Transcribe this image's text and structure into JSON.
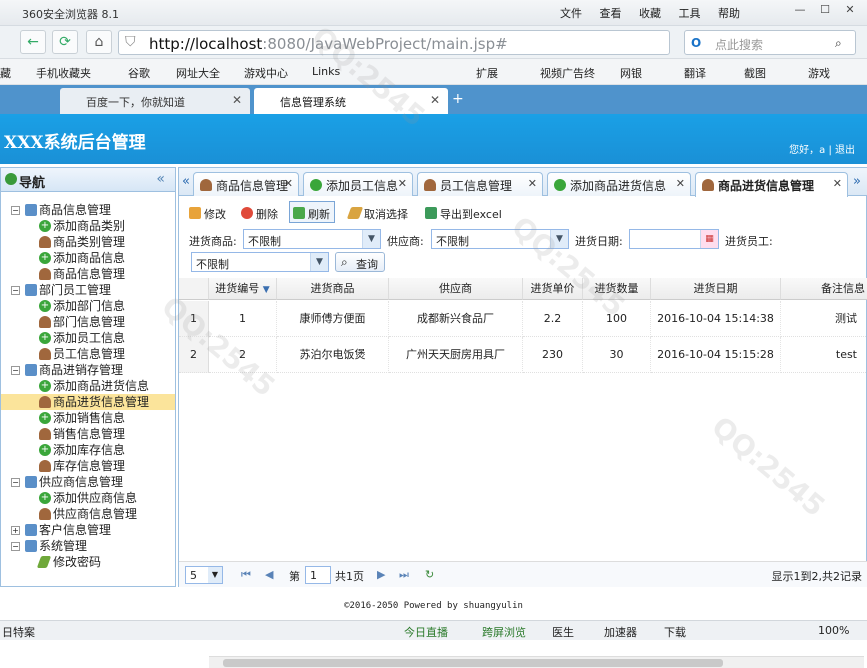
{
  "browser": {
    "title": "360安全浏览器 8.1",
    "menus": [
      "文件",
      "查看",
      "收藏",
      "工具",
      "帮助"
    ],
    "url_host": "http://localhost",
    "url_rest": ":8080/JavaWebProject/main.jsp#",
    "search_placeholder": "点此搜索",
    "bookmarks": [
      "藏",
      "手机收藏夹",
      "谷歌",
      "网址大全",
      "游戏中心",
      "Links",
      "扩展",
      "视频广告终",
      "网银",
      "翻译",
      "截图",
      "游戏"
    ],
    "tabs": [
      {
        "label": "百度一下，你就知道"
      },
      {
        "label": "信息管理系统"
      }
    ]
  },
  "header": {
    "title": "XXX系统后台管理",
    "greeting": "您好，a",
    "logout": "退出"
  },
  "nav": {
    "title": "导航",
    "groups": [
      {
        "label": "商品信息管理",
        "items": [
          "添加商品类别",
          "商品类别管理",
          "添加商品信息",
          "商品信息管理"
        ]
      },
      {
        "label": "部门员工管理",
        "items": [
          "添加部门信息",
          "部门信息管理",
          "添加员工信息",
          "员工信息管理"
        ]
      },
      {
        "label": "商品进销存管理",
        "items": [
          "添加商品进货信息",
          "商品进货信息管理",
          "添加销售信息",
          "销售信息管理",
          "添加库存信息",
          "库存信息管理"
        ]
      },
      {
        "label": "供应商信息管理",
        "items": [
          "添加供应商信息",
          "供应商信息管理"
        ]
      },
      {
        "label": "客户信息管理",
        "items": []
      },
      {
        "label": "系统管理",
        "items": [
          "修改密码"
        ]
      }
    ]
  },
  "main": {
    "tabs": [
      "商品信息管理",
      "添加员工信息",
      "员工信息管理",
      "添加商品进货信息",
      "商品进货信息管理"
    ],
    "toolbar": {
      "edit": "修改",
      "delete": "删除",
      "refresh": "刷新",
      "cancel_select": "取消选择",
      "export": "导出到excel"
    },
    "filters": {
      "goods_label": "进货商品:",
      "goods_value": "不限制",
      "supplier_label": "供应商:",
      "supplier_value": "不限制",
      "date_label": "进货日期:",
      "employee_label": "进货员工:",
      "employee_value": "不限制",
      "query_button": "查询"
    },
    "grid": {
      "columns": [
        "进货编号",
        "进货商品",
        "供应商",
        "进货单价",
        "进货数量",
        "进货日期",
        "备注信息"
      ],
      "rows": [
        {
          "rownum": "1",
          "cells": [
            "1",
            "康师傅方便面",
            "成都新兴食品厂",
            "2.2",
            "100",
            "2016-10-04 15:14:38",
            "测试"
          ]
        },
        {
          "rownum": "2",
          "cells": [
            "2",
            "苏泊尔电饭煲",
            "广州天天厨房用具厂",
            "230",
            "30",
            "2016-10-04 15:15:28",
            "test"
          ]
        }
      ]
    },
    "pager": {
      "page_size": "5",
      "page_prefix": "第",
      "page_number": "1",
      "page_total": "共1页",
      "summary": "显示1到2,共2记录"
    }
  },
  "footer": "©2016-2050  Powered by shuangyulin",
  "statusbar": {
    "left": "日特案",
    "items": [
      "今日直播",
      "跨屏浏览",
      "医生",
      "加速器",
      "下载",
      "100%"
    ]
  }
}
